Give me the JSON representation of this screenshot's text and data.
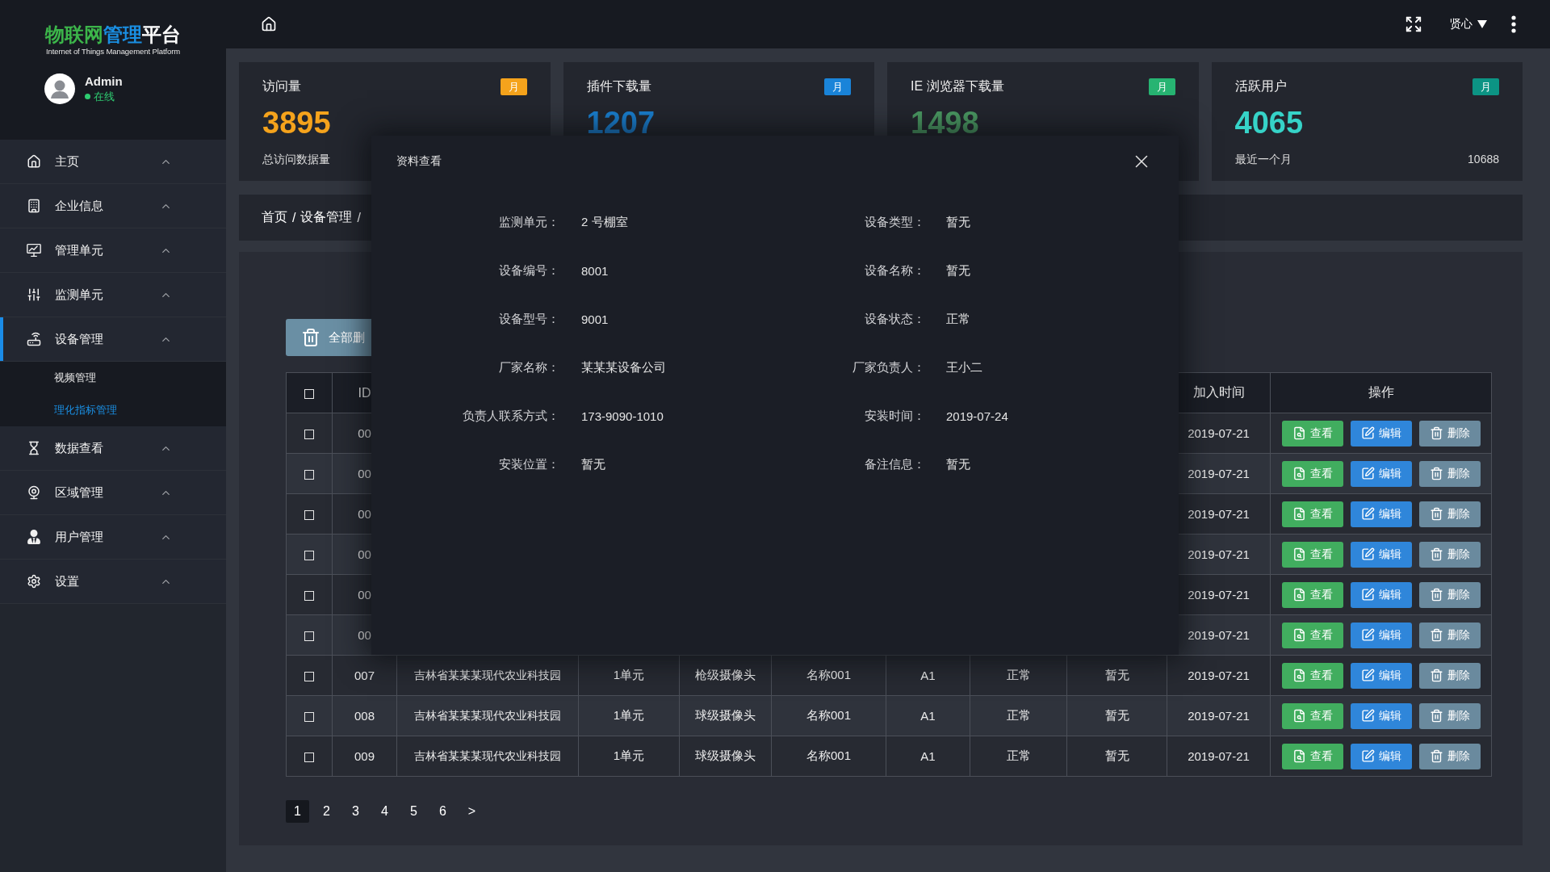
{
  "sidebar": {
    "logo": [
      {
        "text": "物联网",
        "color": "#3cb54a"
      },
      {
        "text": "管理",
        "color": "#1a8fe3"
      },
      {
        "text": "平台",
        "color": "#ffffff"
      }
    ],
    "tagline": "Internet of Things Management Platform",
    "user": {
      "name": "Admin",
      "status": "在线",
      "online": true
    },
    "items": [
      {
        "label": "主页",
        "selected": false
      },
      {
        "label": "企业信息",
        "selected": false
      },
      {
        "label": "管理单元",
        "selected": false
      },
      {
        "label": "监测单元",
        "selected": false
      },
      {
        "label": "设备管理",
        "selected": true,
        "children": [
          {
            "label": "视频管理",
            "selected": false
          },
          {
            "label": "理化指标管理",
            "selected": true
          }
        ]
      },
      {
        "label": "数据查看",
        "selected": false
      },
      {
        "label": "区域管理",
        "selected": false
      },
      {
        "label": "用户管理",
        "selected": false
      },
      {
        "label": "设置",
        "selected": false
      }
    ]
  },
  "header": {
    "user": "贤心"
  },
  "cards": [
    {
      "title": "访问量",
      "badge": {
        "label": "月",
        "color": "#f5a31c"
      },
      "value": "3895",
      "color": "#f5a31c",
      "caption": "总访问数据量"
    },
    {
      "title": "插件下载量",
      "badge": {
        "label": "月",
        "color": "#1a84d9"
      },
      "value": "1207",
      "color": "#1a7fd0"
    },
    {
      "title": "IE 浏览器下载量",
      "badge": {
        "label": "月",
        "color": "#27b472"
      },
      "value": "1498",
      "color": "#4b9a63"
    },
    {
      "title": "活跃用户",
      "badge": {
        "label": "月",
        "color": "#0c9484"
      },
      "value": "4065",
      "color": "#36d3c8",
      "caption": "最近一个月",
      "total": "10688"
    }
  ],
  "breadcrumb": {
    "items": [
      "首页",
      "设备管理"
    ],
    "separators": [
      "/",
      "/"
    ]
  },
  "toolbar": [
    {
      "kind": "delete_all",
      "label": "全部删"
    }
  ],
  "table": {
    "select_all_checked": false,
    "columns": {
      "id": "ID",
      "joined": "加入时间",
      "actions": "操作"
    },
    "rows": [
      {
        "checked": false,
        "id": "00",
        "joined": "2019-07-21",
        "actions": [
          {
            "kind": "view",
            "label": "查看"
          },
          {
            "kind": "edit",
            "label": "编辑"
          },
          {
            "kind": "delete",
            "label": "删除"
          }
        ]
      },
      {
        "checked": false,
        "id": "00",
        "joined": "2019-07-21",
        "actions": [
          {
            "kind": "view",
            "label": "查看"
          },
          {
            "kind": "edit",
            "label": "编辑"
          },
          {
            "kind": "delete",
            "label": "删除"
          }
        ]
      },
      {
        "checked": false,
        "id": "00",
        "joined": "2019-07-21",
        "actions": [
          {
            "kind": "view",
            "label": "查看"
          },
          {
            "kind": "edit",
            "label": "编辑"
          },
          {
            "kind": "delete",
            "label": "删除"
          }
        ]
      },
      {
        "checked": false,
        "id": "00",
        "joined": "2019-07-21",
        "actions": [
          {
            "kind": "view",
            "label": "查看"
          },
          {
            "kind": "edit",
            "label": "编辑"
          },
          {
            "kind": "delete",
            "label": "删除"
          }
        ]
      },
      {
        "checked": false,
        "id": "00",
        "joined": "2019-07-21",
        "actions": [
          {
            "kind": "view",
            "label": "查看"
          },
          {
            "kind": "edit",
            "label": "编辑"
          },
          {
            "kind": "delete",
            "label": "删除"
          }
        ]
      },
      {
        "checked": false,
        "id": "00",
        "joined": "2019-07-21",
        "actions": [
          {
            "kind": "view",
            "label": "查看"
          },
          {
            "kind": "edit",
            "label": "编辑"
          },
          {
            "kind": "delete",
            "label": "删除"
          }
        ]
      },
      {
        "checked": false,
        "id": "007",
        "company": "吉林省某某某现代农业科技园",
        "unit": "1单元",
        "type": "枪级摄像头",
        "name": "名称001",
        "code": "A1",
        "status": "正常",
        "maker": "暂无",
        "joined": "2019-07-21",
        "actions": [
          {
            "kind": "view",
            "label": "查看"
          },
          {
            "kind": "edit",
            "label": "编辑"
          },
          {
            "kind": "delete",
            "label": "删除"
          }
        ]
      },
      {
        "checked": false,
        "id": "008",
        "company": "吉林省某某某现代农业科技园",
        "unit": "1单元",
        "type": "球级摄像头",
        "name": "名称001",
        "code": "A1",
        "status": "正常",
        "maker": "暂无",
        "joined": "2019-07-21",
        "actions": [
          {
            "kind": "view",
            "label": "查看"
          },
          {
            "kind": "edit",
            "label": "编辑"
          },
          {
            "kind": "delete",
            "label": "删除"
          }
        ]
      },
      {
        "checked": false,
        "id": "009",
        "company": "吉林省某某某现代农业科技园",
        "unit": "1单元",
        "type": "球级摄像头",
        "name": "名称001",
        "code": "A1",
        "status": "正常",
        "maker": "暂无",
        "joined": "2019-07-21",
        "actions": [
          {
            "kind": "view",
            "label": "查看"
          },
          {
            "kind": "edit",
            "label": "编辑"
          },
          {
            "kind": "delete",
            "label": "删除"
          }
        ]
      }
    ]
  },
  "pagination": {
    "pages": [
      {
        "label": "1",
        "selected": true
      },
      {
        "label": "2",
        "selected": false
      },
      {
        "label": "3",
        "selected": false
      },
      {
        "label": "4",
        "selected": false
      },
      {
        "label": "5",
        "selected": false
      },
      {
        "label": "6",
        "selected": false
      }
    ],
    "next": ">"
  },
  "dialog": {
    "title": "资料查看",
    "fields": [
      {
        "label": "监测单元：",
        "value": "2 号棚室"
      },
      {
        "label": "设备类型：",
        "value": "暂无"
      },
      {
        "label": "设备编号：",
        "value": "8001"
      },
      {
        "label": "设备名称：",
        "value": "暂无"
      },
      {
        "label": "设备型号：",
        "value": "9001"
      },
      {
        "label": "设备状态：",
        "value": "正常"
      },
      {
        "label": "厂家名称：",
        "value": "某某某设备公司"
      },
      {
        "label": "厂家负责人：",
        "value": "王小二"
      },
      {
        "label": "负责人联系方式：",
        "value": "173-9090-1010"
      },
      {
        "label": "安装时间：",
        "value": "2019-07-24"
      },
      {
        "label": "安装位置：",
        "value": "暂无"
      },
      {
        "label": "备注信息：",
        "value": "暂无"
      }
    ]
  }
}
